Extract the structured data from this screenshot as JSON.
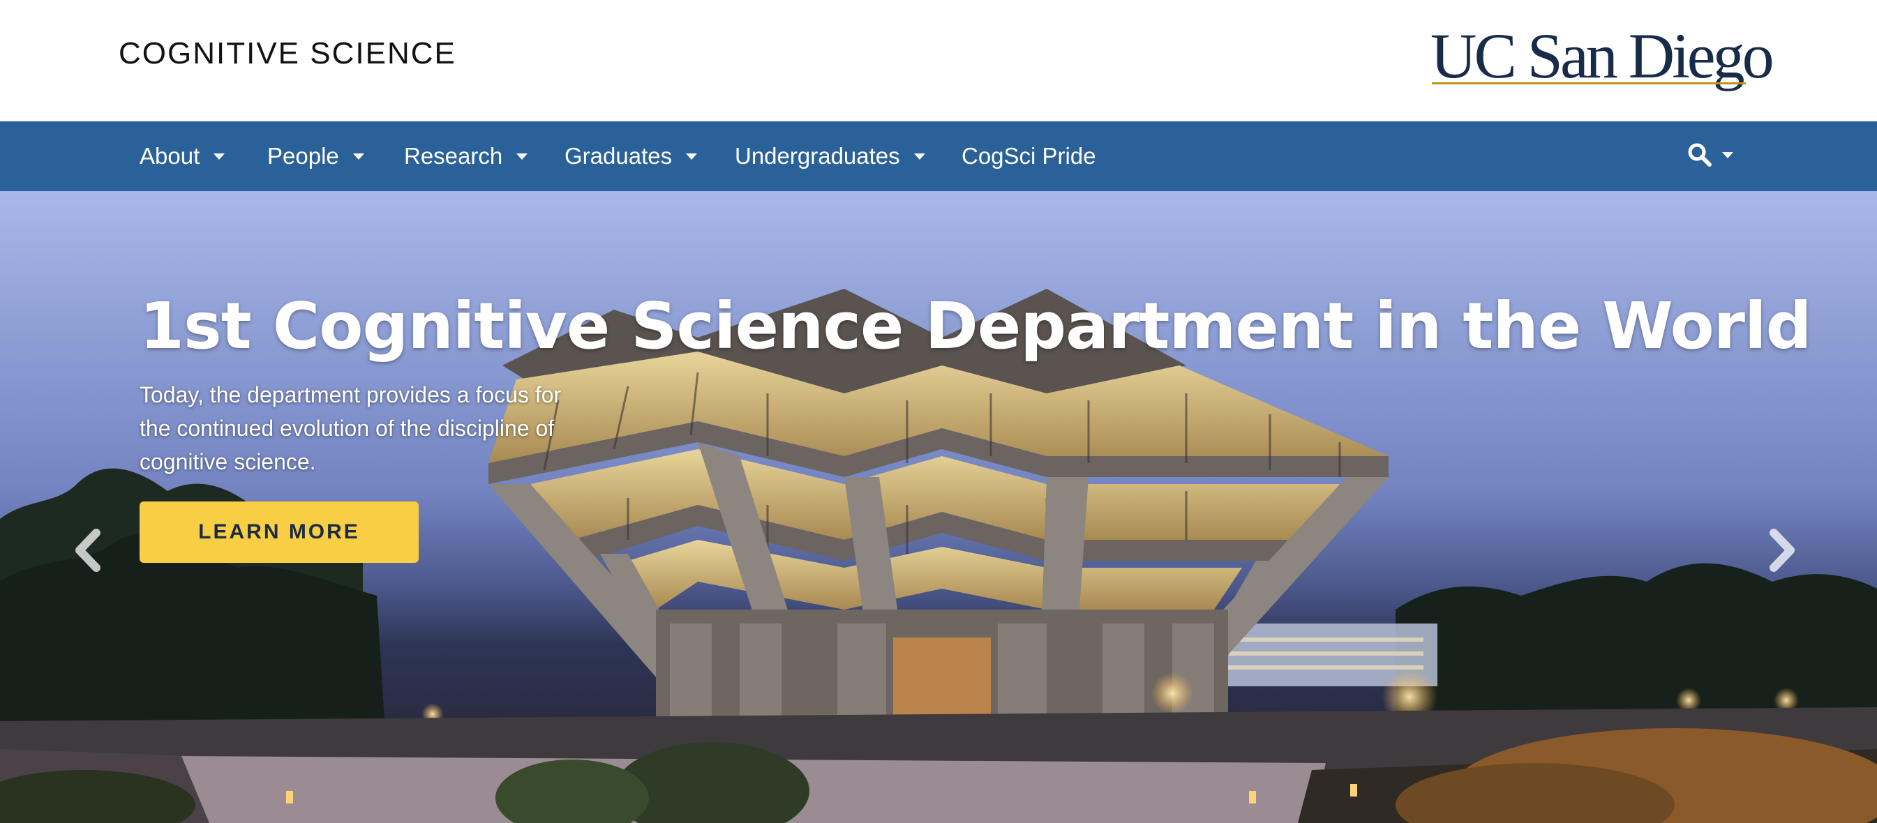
{
  "header": {
    "site_title": "COGNITIVE SCIENCE",
    "logo_text": "UC San Diego"
  },
  "nav": {
    "items": [
      {
        "label": "About",
        "has_dropdown": true
      },
      {
        "label": "People",
        "has_dropdown": true
      },
      {
        "label": "Research",
        "has_dropdown": true
      },
      {
        "label": "Graduates",
        "has_dropdown": true
      },
      {
        "label": "Undergraduates",
        "has_dropdown": true
      },
      {
        "label": "CogSci Pride",
        "has_dropdown": false
      }
    ],
    "search_icon": "search-icon"
  },
  "hero": {
    "title": "1st Cognitive Science Department in the World",
    "description": "Today, the department provides a focus for the continued evolution of the discipline of cognitive science.",
    "button_label": "LEARN MORE",
    "prev_icon": "chevron-left-icon",
    "next_icon": "chevron-right-icon"
  },
  "colors": {
    "nav_background": "#2b6199",
    "button_background": "#f8ce45",
    "logo_navy": "#182b49",
    "logo_gold": "#c69214"
  }
}
